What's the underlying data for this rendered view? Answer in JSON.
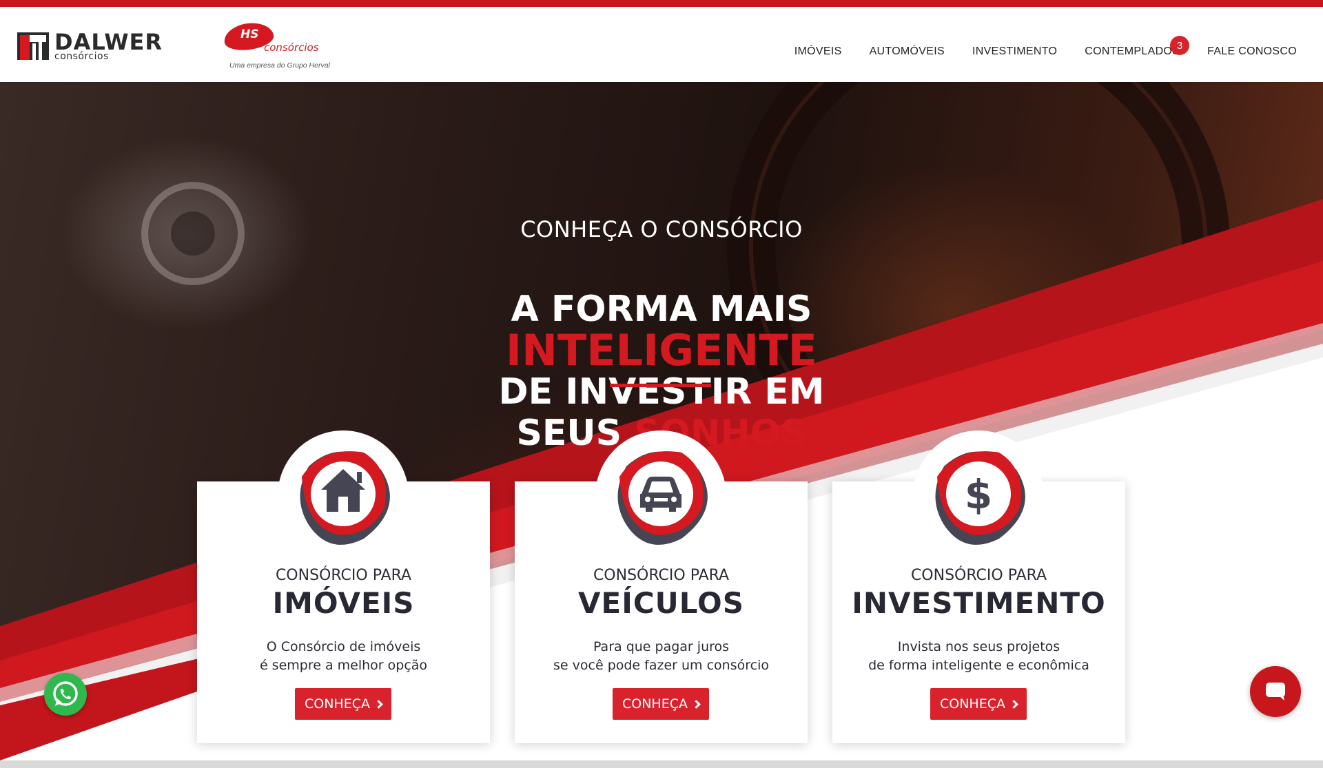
{
  "brand": {
    "dalwer_name": "DALWER",
    "dalwer_sub": "consórcios",
    "hs_initials": "HS",
    "hs_word": "consórcios",
    "hs_tagline": "Uma empresa do Grupo Herval"
  },
  "nav": {
    "items": [
      "IMÓVEIS",
      "AUTOMÓVEIS",
      "INVESTIMENTO",
      "CONTEMPLADOS",
      "FALE CONOSCO"
    ],
    "contemplados_badge": "3"
  },
  "hero": {
    "kicker": "CONHEÇA O CONSÓRCIO",
    "line1": "A FORMA MAIS",
    "line2": "INTELIGENTE",
    "line3": "DE INVESTIR EM",
    "line4_white": "SEUS ",
    "line4_red": "SONHOS"
  },
  "cards": [
    {
      "pre": "CONSÓRCIO PARA",
      "title": "IMÓVEIS",
      "desc1": "O Consórcio de imóveis",
      "desc2": "é sempre a melhor opção",
      "button": "CONHEÇA",
      "icon": "house-icon"
    },
    {
      "pre": "CONSÓRCIO PARA",
      "title": "VEÍCULOS",
      "desc1": "Para que pagar juros",
      "desc2": "se você pode fazer um consórcio",
      "button": "CONHEÇA",
      "icon": "car-icon"
    },
    {
      "pre": "CONSÓRCIO PARA",
      "title": "INVESTIMENTO",
      "desc1": "Invista nos seus projetos",
      "desc2": "de forma inteligente e econômica",
      "button": "CONHEÇA",
      "icon": "dollar-icon"
    }
  ],
  "floating": {
    "whatsapp_icon": "whatsapp-icon",
    "chat_icon": "chat-icon"
  },
  "colors": {
    "brand_red": "#d51920",
    "button_red": "#d9232c",
    "dark_text": "#272833"
  }
}
